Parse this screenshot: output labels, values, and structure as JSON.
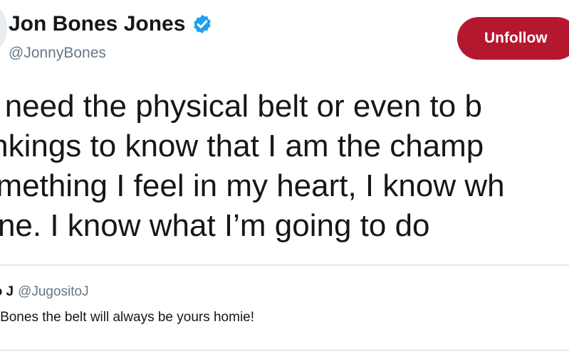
{
  "profile": {
    "display_name": "Jon Bones Jones",
    "handle": "@JonnyBones",
    "verified": true
  },
  "actions": {
    "follow_button_label": "Unfollow"
  },
  "tweet": {
    "lines": [
      "n’t need the physical belt or even to b",
      "rankings to know that I am the champ",
      "something I feel in my heart, I know wh",
      " done. I know what I’m going to do"
    ]
  },
  "quoted_tweet": {
    "display_name": "ito J",
    "handle": "@JugositoJ",
    "text": "nyBones the belt will always be yours homie!"
  },
  "colors": {
    "unfollow_button": "#b5172f",
    "verified_badge": "#1da1f2",
    "secondary_text": "#657786",
    "border": "#e1e8ed"
  },
  "icons": {
    "verified": "verified-badge-icon"
  }
}
